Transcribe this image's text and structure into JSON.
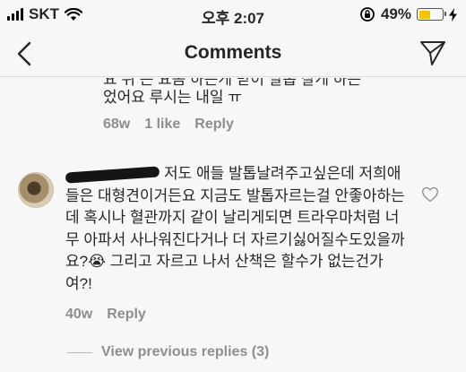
{
  "status_bar": {
    "carrier": "SKT",
    "time": "오후 2:07",
    "battery_text": "49%",
    "battery_level": 0.49,
    "icons": [
      "signal-icon",
      "wifi-icon",
      "rotation-lock-icon",
      "battery-icon",
      "charging-bolt-icon"
    ]
  },
  "nav": {
    "title": "Comments",
    "back_icon": "chevron-left-icon",
    "send_icon": "paper-plane-icon"
  },
  "comments": [
    {
      "text_clipped": "요 뒤 는 요옴 하는게 받이 발톱 잘게 하는",
      "text": "었어요 루시는 내일 ㅠ",
      "age": "68w",
      "likes": "1 like",
      "reply_label": "Reply"
    },
    {
      "text": "저도 애들 발톱날려주고싶은데 저희애들은 대형견이거든요 지금도 발톱자르는걸 안좋아하는데 혹시나 혈관까지 같이 날리게되면 트라우마처럼 너무 아파서 사나워진다거나 더 자르기싫어질수도있을까요?😭 그리고 자르고 나서 산책은 할수가 없는건가여?!",
      "age": "40w",
      "reply_label": "Reply",
      "like_icon": "heart-outline-icon"
    }
  ],
  "view_replies": "View previous replies (3)"
}
